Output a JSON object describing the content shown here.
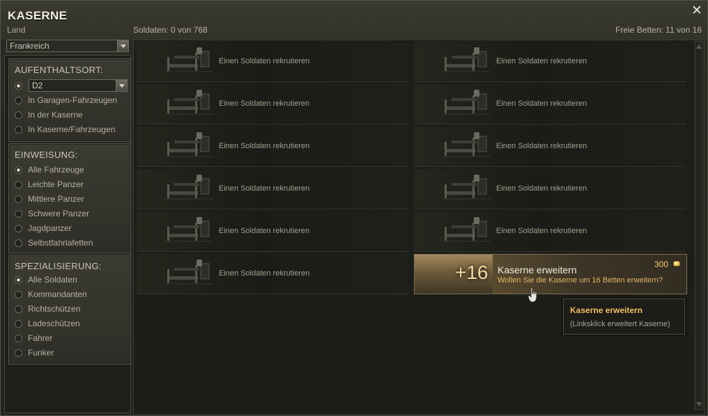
{
  "window": {
    "title": "KASERNE",
    "subtitle": "Land",
    "soldiers_label": "Soldaten: 0 von 768",
    "free_beds_label": "Freie Betten: 11 von 16",
    "close_icon": "close-icon"
  },
  "country_filter": {
    "value": "Frankreich"
  },
  "location_panel": {
    "title": "AUFENTHALTSORT:",
    "selected_vehicle": "D2",
    "options": [
      {
        "label": "In Garagen-Fahrzeugen",
        "selected": false
      },
      {
        "label": "In der Kaserne",
        "selected": false
      },
      {
        "label": "In Kaserne/Fahrzeugen",
        "selected": false
      }
    ],
    "vehicle_radio_selected": true
  },
  "assignment_panel": {
    "title": "EINWEISUNG:",
    "options": [
      {
        "label": "Alle Fahrzeuge",
        "selected": true
      },
      {
        "label": "Leichte Panzer",
        "selected": false
      },
      {
        "label": "Mittlere Panzer",
        "selected": false
      },
      {
        "label": "Schwere Panzer",
        "selected": false
      },
      {
        "label": "Jagdpanzer",
        "selected": false
      },
      {
        "label": "Selbstfahrlafetten",
        "selected": false
      }
    ]
  },
  "specialization_panel": {
    "title": "SPEZIALISIERUNG:",
    "options": [
      {
        "label": "Alle Soldaten",
        "selected": true
      },
      {
        "label": "Kommandanten",
        "selected": false
      },
      {
        "label": "Richtschützen",
        "selected": false
      },
      {
        "label": "Ladeschützen",
        "selected": false
      },
      {
        "label": "Fahrer",
        "selected": false
      },
      {
        "label": "Funker",
        "selected": false
      }
    ]
  },
  "slots": {
    "recruit_label": "Einen Soldaten rekrutieren",
    "count": 11
  },
  "expand_card": {
    "plus": "+16",
    "title": "Kaserne erweitern",
    "subtitle": "Wollen Sie die Kaserne um 16 Betten erweitern?",
    "price": "300",
    "currency_icon": "gold-coin-icon"
  },
  "tooltip": {
    "title": "Kaserne erweitern",
    "text": "(Linksklick erweitert Kaserne)"
  }
}
